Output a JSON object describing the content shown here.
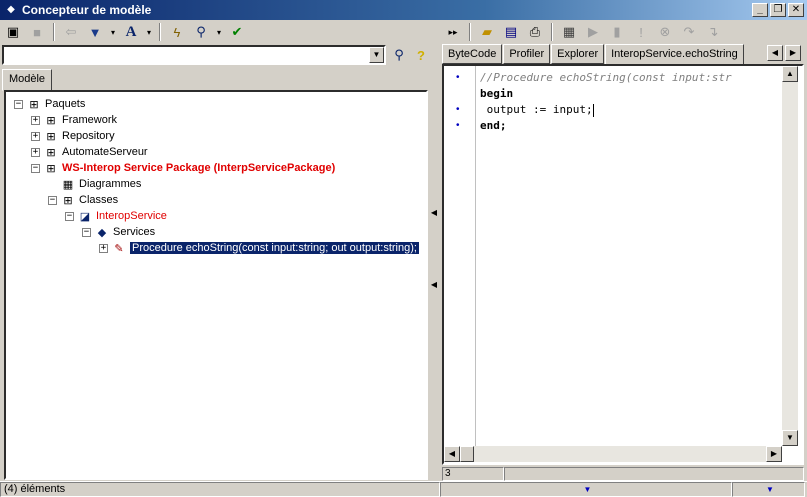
{
  "window": {
    "title": "Concepteur de modèle",
    "controls": [
      "_",
      "❐",
      "✕"
    ]
  },
  "left_tab": "Modèle",
  "tree": [
    {
      "label": "Paquets",
      "level": 0,
      "expander": "−",
      "icon": "package-icon",
      "style": "normal"
    },
    {
      "label": "Framework",
      "level": 1,
      "expander": "+",
      "icon": "package-icon",
      "style": "normal"
    },
    {
      "label": "Repository",
      "level": 1,
      "expander": "+",
      "icon": "package-icon",
      "style": "normal"
    },
    {
      "label": "AutomateServeur",
      "level": 1,
      "expander": "+",
      "icon": "package-icon",
      "style": "normal"
    },
    {
      "label": "WS-Interop Service Package (InterpServicePackage)",
      "level": 1,
      "expander": "−",
      "icon": "package-icon",
      "style": "red-bold"
    },
    {
      "label": "Diagrammes",
      "level": 2,
      "expander": "",
      "icon": "diagram-icon",
      "style": "normal"
    },
    {
      "label": "Classes",
      "level": 2,
      "expander": "−",
      "icon": "package-icon",
      "style": "normal"
    },
    {
      "label": "InteropService",
      "level": 3,
      "expander": "−",
      "icon": "class-icon",
      "style": "red"
    },
    {
      "label": "Services",
      "level": 4,
      "expander": "−",
      "icon": "services-icon",
      "style": "normal"
    },
    {
      "label": "Procedure echoString(const input:string; out output:string);",
      "level": 5,
      "expander": "+",
      "icon": "method-icon",
      "style": "selected"
    }
  ],
  "right_tabs": [
    "ByteCode",
    "Profiler",
    "Explorer",
    "InteropService.echoString"
  ],
  "active_right_tab": 3,
  "code_lines": [
    {
      "text": "//Procedure echoString(const input:str",
      "kind": "comment",
      "breakpoint": true
    },
    {
      "text": "begin",
      "kind": "keyword",
      "breakpoint": false
    },
    {
      "text": " output := input;",
      "kind": "normal",
      "breakpoint": true
    },
    {
      "text": "end;",
      "kind": "keyword",
      "breakpoint": true
    }
  ],
  "editor_status": {
    "line": "3",
    "col": ""
  },
  "status_bar": {
    "items_text": "(4) éléments"
  },
  "colors": {
    "title_bar": "#0a246a",
    "selection": "#0a246a",
    "highlight_red": "#e00000",
    "background": "#d4d0c8"
  }
}
